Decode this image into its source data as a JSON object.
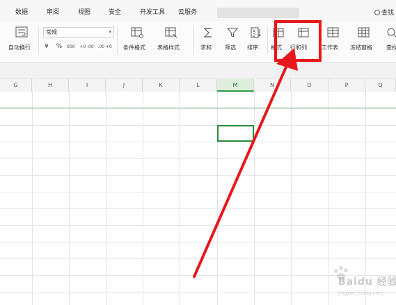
{
  "menu_tabs": [
    "数据",
    "审阅",
    "视图",
    "安全",
    "开发工具",
    "云服务"
  ],
  "search": {
    "label": "查找"
  },
  "ribbon": {
    "wrap_text": "自动换行",
    "number_format": "常规",
    "number_tools": [
      "¥",
      "%",
      "000",
      "+0 .00",
      ".00 +0"
    ],
    "conditional_format": "条件格式",
    "table_style": "表格样式",
    "sum": "求和",
    "filter": "筛选",
    "sort": "排序",
    "format": "格式",
    "rows_cols": "行和列",
    "worksheet": "工作表",
    "freeze_panes": "冻结窗格",
    "find": "查找"
  },
  "columns": [
    "G",
    "H",
    "I",
    "J",
    "K",
    "L",
    "M",
    "N",
    "O",
    "P",
    "Q"
  ],
  "active_column": "M",
  "colors": {
    "highlight_box": "#e8171b",
    "selection": "#2e8b3e",
    "active_column": "#2e9b46"
  },
  "watermark": {
    "brand": "Baidu 经验",
    "url": "jingyan.baidu.com"
  }
}
